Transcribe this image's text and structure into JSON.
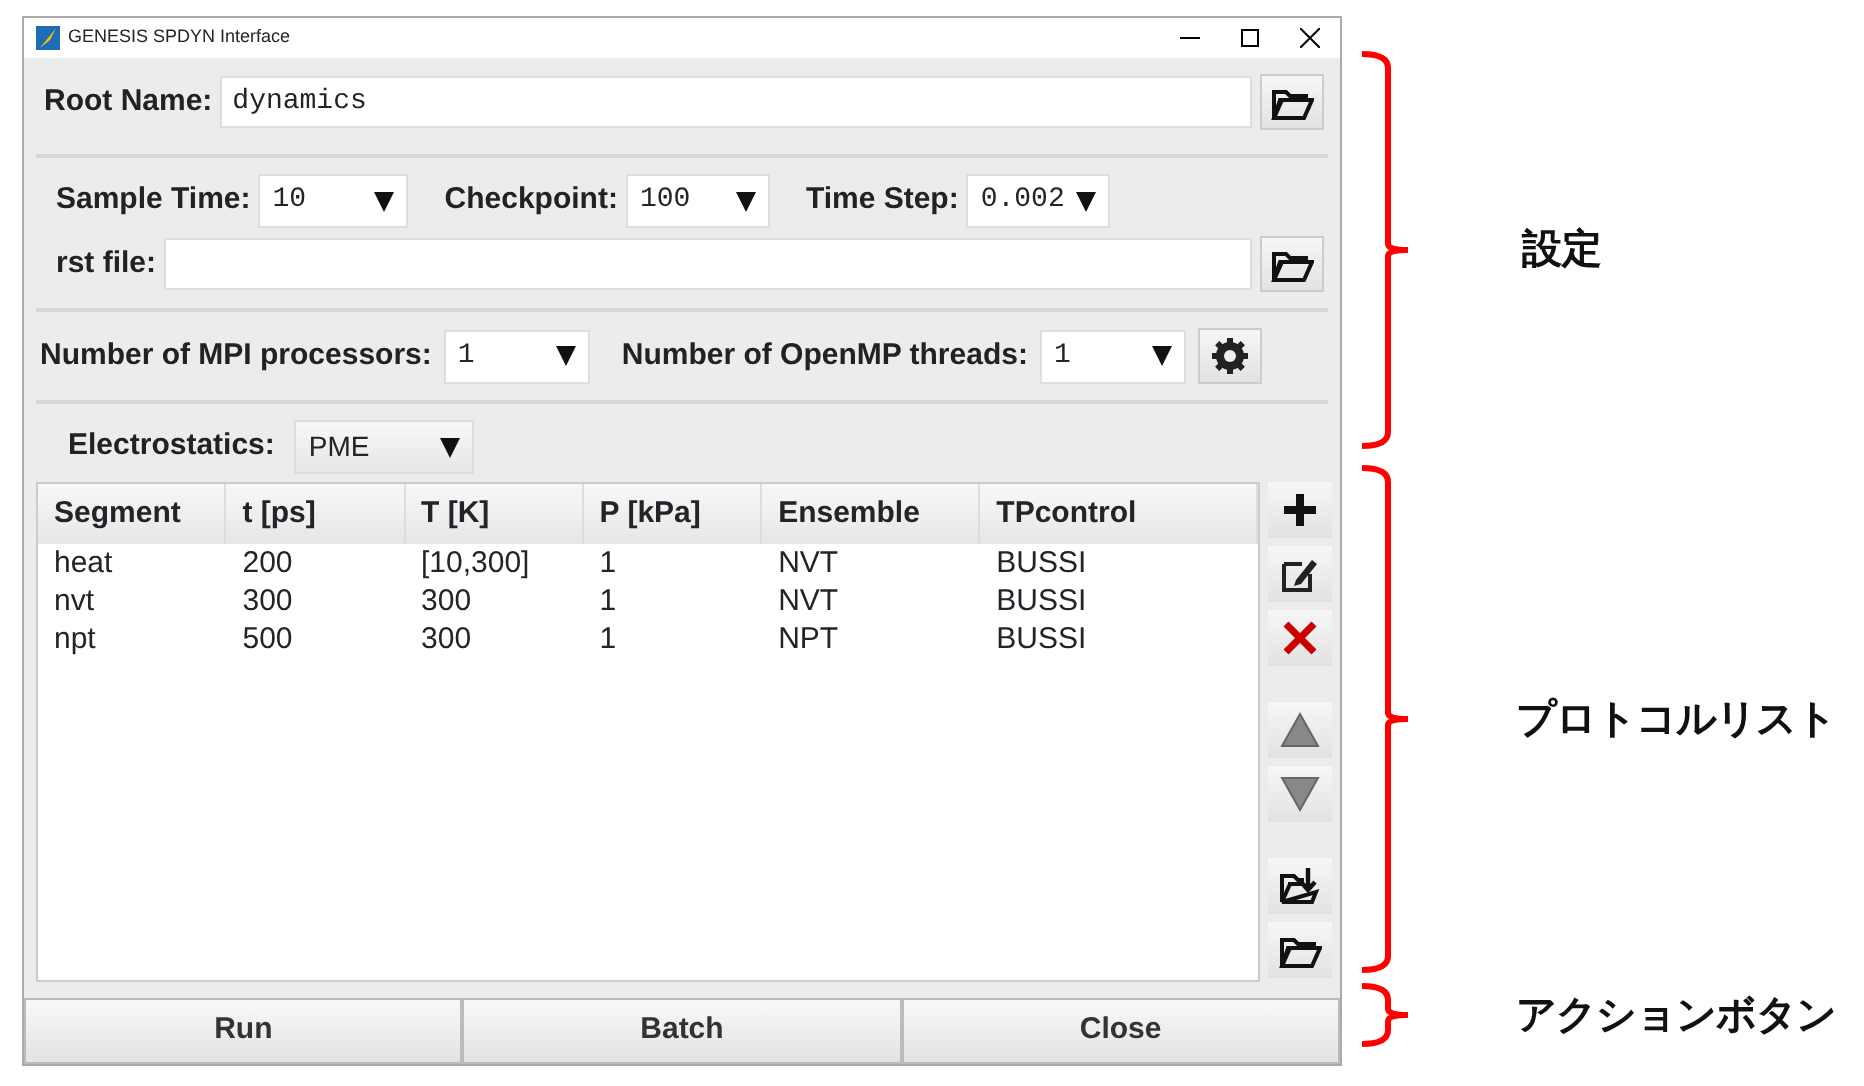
{
  "window": {
    "title": "GENESIS SPDYN Interface"
  },
  "root_name": {
    "label": "Root Name:",
    "value": "dynamics"
  },
  "sample_time": {
    "label": "Sample Time:",
    "value": "10"
  },
  "checkpoint": {
    "label": "Checkpoint:",
    "value": "100"
  },
  "time_step": {
    "label": "Time Step:",
    "value": "0.002"
  },
  "rst_file": {
    "label": "rst file:"
  },
  "mpi": {
    "label": "Number of MPI processors:",
    "value": "1"
  },
  "openmp": {
    "label": "Number of OpenMP threads:",
    "value": "1"
  },
  "electrostatics": {
    "label": "Electrostatics:",
    "value": "PME"
  },
  "table": {
    "columns": [
      "Segment",
      "t [ps]",
      "T [K]",
      "P [kPa]",
      "Ensemble",
      "TPcontrol"
    ],
    "rows": [
      [
        "heat",
        "200",
        "[10,300]",
        "1",
        "NVT",
        "BUSSI"
      ],
      [
        "nvt",
        "300",
        "300",
        "1",
        "NVT",
        "BUSSI"
      ],
      [
        "npt",
        "500",
        "300",
        "1",
        "NPT",
        "BUSSI"
      ]
    ]
  },
  "side_buttons": [
    {
      "kind": "add"
    },
    {
      "kind": "edit"
    },
    {
      "kind": "delete"
    },
    {
      "kind": "up"
    },
    {
      "kind": "down"
    },
    {
      "kind": "save"
    },
    {
      "kind": "open"
    }
  ],
  "action_buttons": [
    "Run",
    "Batch",
    "Close"
  ],
  "annotations": [
    "設定",
    "プロトコルリスト",
    "アクションボタン"
  ]
}
